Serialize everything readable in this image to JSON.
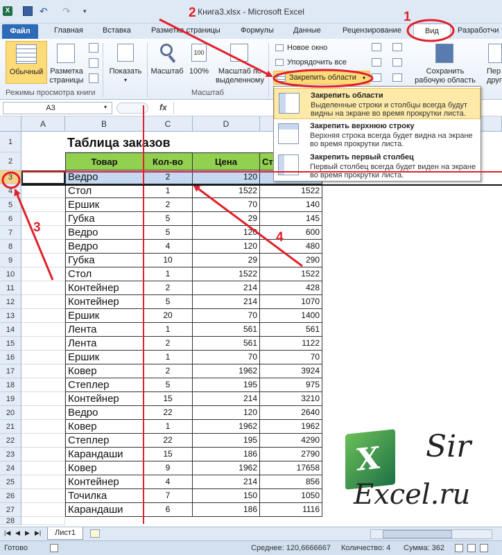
{
  "window": {
    "title": "Книга3.xlsx - Microsoft Excel"
  },
  "ribbon_tabs": {
    "file": "Файл",
    "home": "Главная",
    "insert": "Вставка",
    "page_layout": "Разметка страницы",
    "formulas": "Формулы",
    "data": "Данные",
    "review": "Рецензирование",
    "view": "Вид",
    "developer": "Разработчи"
  },
  "ribbon": {
    "normal": "Обычный",
    "page_layout_1": "Разметка",
    "page_layout_2": "страницы",
    "show": "Показать",
    "zoom": "Масштаб",
    "zoom100": "100%",
    "zoom_sel_1": "Масштаб по",
    "zoom_sel_2": "выделенному",
    "new_window": "Новое окно",
    "arrange_all": "Упорядочить все",
    "freeze_panes": "Закрепить области",
    "save_ws_1": "Сохранить",
    "save_ws_2": "рабочую область",
    "switch_1": "Пер",
    "switch_2": "другое",
    "group_views": "Режимы просмотра книги",
    "group_zoom": "Масштаб"
  },
  "formula_bar": {
    "name_box": "A3",
    "fx": "fx",
    "value": ""
  },
  "columns": [
    "A",
    "B",
    "C",
    "D",
    "E"
  ],
  "sheet": {
    "title": "Таблица заказов",
    "headers": [
      "Товар",
      "Кол-во",
      "Цена",
      "Ст"
    ],
    "rows": [
      {
        "n": "3",
        "item": "Ведро",
        "qty": "2",
        "price": "120",
        "sum": ""
      },
      {
        "n": "4",
        "item": "Стол",
        "qty": "1",
        "price": "1522",
        "sum": "1522"
      },
      {
        "n": "5",
        "item": "Ершик",
        "qty": "2",
        "price": "70",
        "sum": "140"
      },
      {
        "n": "6",
        "item": "Губка",
        "qty": "5",
        "price": "29",
        "sum": "145"
      },
      {
        "n": "7",
        "item": "Ведро",
        "qty": "5",
        "price": "120",
        "sum": "600"
      },
      {
        "n": "8",
        "item": "Ведро",
        "qty": "4",
        "price": "120",
        "sum": "480"
      },
      {
        "n": "9",
        "item": "Губка",
        "qty": "10",
        "price": "29",
        "sum": "290"
      },
      {
        "n": "10",
        "item": "Стол",
        "qty": "1",
        "price": "1522",
        "sum": "1522"
      },
      {
        "n": "11",
        "item": "Контейнер",
        "qty": "2",
        "price": "214",
        "sum": "428"
      },
      {
        "n": "12",
        "item": "Контейнер",
        "qty": "5",
        "price": "214",
        "sum": "1070"
      },
      {
        "n": "13",
        "item": "Ершик",
        "qty": "20",
        "price": "70",
        "sum": "1400"
      },
      {
        "n": "14",
        "item": "Лента",
        "qty": "1",
        "price": "561",
        "sum": "561"
      },
      {
        "n": "15",
        "item": "Лента",
        "qty": "2",
        "price": "561",
        "sum": "1122"
      },
      {
        "n": "16",
        "item": "Ершик",
        "qty": "1",
        "price": "70",
        "sum": "70"
      },
      {
        "n": "17",
        "item": "Ковер",
        "qty": "2",
        "price": "1962",
        "sum": "3924"
      },
      {
        "n": "18",
        "item": "Степлер",
        "qty": "5",
        "price": "195",
        "sum": "975"
      },
      {
        "n": "19",
        "item": "Контейнер",
        "qty": "15",
        "price": "214",
        "sum": "3210"
      },
      {
        "n": "20",
        "item": "Ведро",
        "qty": "22",
        "price": "120",
        "sum": "2640"
      },
      {
        "n": "21",
        "item": "Ковер",
        "qty": "1",
        "price": "1962",
        "sum": "1962"
      },
      {
        "n": "22",
        "item": "Степлер",
        "qty": "22",
        "price": "195",
        "sum": "4290"
      },
      {
        "n": "23",
        "item": "Карандаши",
        "qty": "15",
        "price": "186",
        "sum": "2790"
      },
      {
        "n": "24",
        "item": "Ковер",
        "qty": "9",
        "price": "1962",
        "sum": "17658"
      },
      {
        "n": "25",
        "item": "Контейнер",
        "qty": "4",
        "price": "214",
        "sum": "856"
      },
      {
        "n": "26",
        "item": "Точилка",
        "qty": "7",
        "price": "150",
        "sum": "1050"
      },
      {
        "n": "27",
        "item": "Карандаши",
        "qty": "6",
        "price": "186",
        "sum": "1116"
      },
      {
        "n": "28",
        "item": "",
        "qty": "",
        "price": "",
        "sum": ""
      }
    ]
  },
  "dropdown": {
    "items": [
      {
        "title": "Закрепить области",
        "desc": "Выделенные строки и столбцы всегда будут видны на экране во время прокрутки листа."
      },
      {
        "title": "Закрепить верхнюю строку",
        "desc": "Верхняя строка всегда будет видна на экране во время прокрутки листа."
      },
      {
        "title": "Закрепить первый столбец",
        "desc": "Первый столбец всегда будет виден на экране во время прокрутки листа."
      }
    ]
  },
  "sheet_tab": "Лист1",
  "status": {
    "ready": "Готово",
    "average": "Среднее: 120,6666667",
    "count": "Количество: 4",
    "sum": "Сумма: 362"
  },
  "annotations": [
    "1",
    "2",
    "3",
    "4"
  ],
  "logo": {
    "line1": "Sir",
    "line2": "Excel.ru",
    "letter": "X"
  },
  "colors": {
    "header_green": "#92d050",
    "selection": "#c5daf2",
    "annotation_red": "#e0202a",
    "file_tab": "#2c6bb7"
  }
}
